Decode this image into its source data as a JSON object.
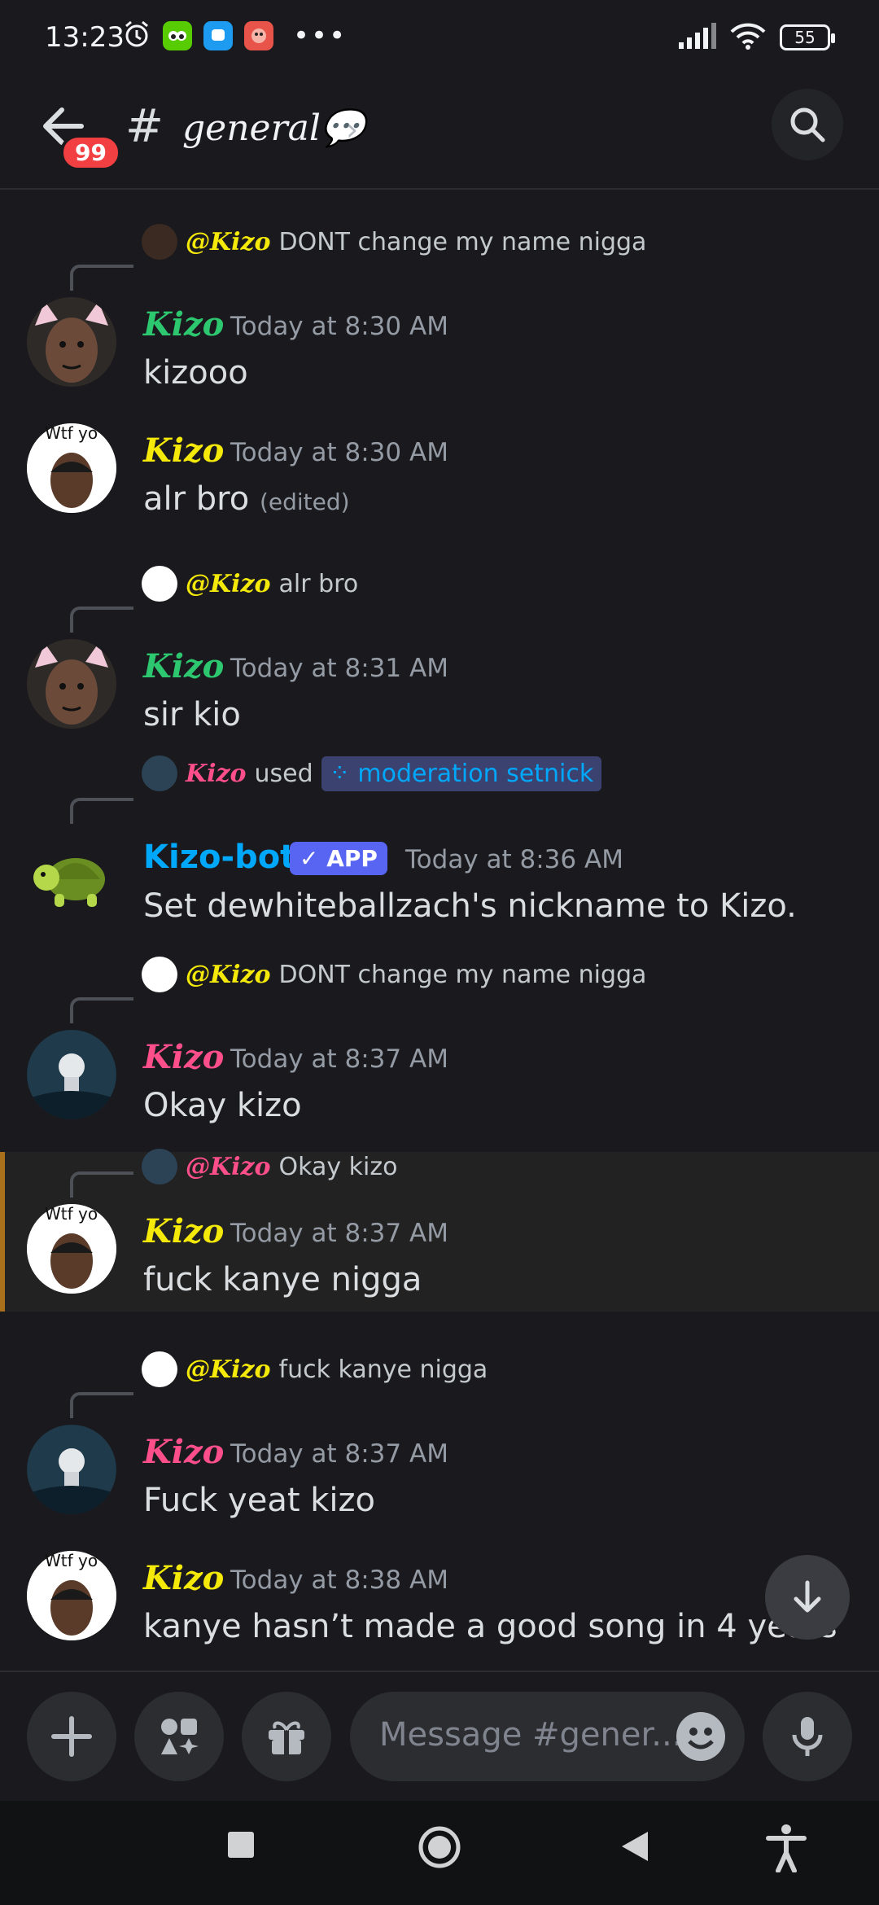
{
  "status_bar": {
    "time": "13:23",
    "battery": "55"
  },
  "header": {
    "unread_badge": "99",
    "hash": "#",
    "channel_name": "general💬",
    "chevron": "›"
  },
  "messages": [
    {
      "reply": {
        "mention": "@Kizo",
        "mention_color": "#f5e90a",
        "text": "DONT change my name nigga"
      },
      "author": "Kizo",
      "author_color": "#2dc770",
      "timestamp": "Today at 8:30 AM",
      "text": "kizooo",
      "avatar": "cat-ears-avatar"
    },
    {
      "author": "Kizo",
      "author_color": "#f5e90a",
      "timestamp": "Today at 8:30 AM",
      "text": "alr bro",
      "edited": "(edited)",
      "avatar": "wtf-yo-avatar",
      "avatar_caption": "Wtf yo"
    },
    {
      "reply": {
        "mention": "@Kizo",
        "mention_color": "#f5e90a",
        "text": "alr bro"
      },
      "author": "Kizo",
      "author_color": "#2dc770",
      "timestamp": "Today at 8:31 AM",
      "text": "sir kio",
      "avatar": "cat-ears-avatar"
    },
    {
      "reply": {
        "mention": "Kizo",
        "mention_color": "#ff4f8b",
        "used": "used",
        "command": "moderation setnick"
      },
      "author": "Kizo-bot",
      "author_color": "#00a8fc",
      "app_tag": "✓ APP",
      "timestamp": "Today at 8:36 AM",
      "text": "Set dewhiteballzach's nickname to Kizo.",
      "avatar": "turtle-avatar"
    },
    {
      "reply": {
        "mention": "@Kizo",
        "mention_color": "#f5e90a",
        "text": "DONT change my name nigga"
      },
      "author": "Kizo",
      "author_color": "#ff4f8b",
      "timestamp": "Today at 8:37 AM",
      "text": "Okay kizo",
      "avatar": "astronaut-avatar"
    },
    {
      "reply": {
        "mention": "@Kizo",
        "mention_color": "#ff4f8b",
        "text": "Okay kizo"
      },
      "author": "Kizo",
      "author_color": "#f5e90a",
      "timestamp": "Today at 8:37 AM",
      "text": "fuck kanye nigga",
      "avatar": "wtf-yo-avatar",
      "avatar_caption": "Wtf yo"
    },
    {
      "reply": {
        "mention": "@Kizo",
        "mention_color": "#f5e90a",
        "text": "fuck kanye nigga"
      },
      "author": "Kizo",
      "author_color": "#ff4f8b",
      "timestamp": "Today at 8:37 AM",
      "text": "Fuck yeat kizo",
      "avatar": "astronaut-avatar"
    },
    {
      "author": "Kizo",
      "author_color": "#f5e90a",
      "timestamp": "Today at 8:38 AM",
      "text": "kanye hasn’t made a good song in 4 years",
      "avatar": "wtf-yo-avatar",
      "avatar_caption": "Wtf yo"
    }
  ],
  "composer": {
    "placeholder": "Message #gener..."
  },
  "colors": {
    "background": "#1a1a1e",
    "accent": "#5865f2",
    "badge": "#f23f42"
  }
}
